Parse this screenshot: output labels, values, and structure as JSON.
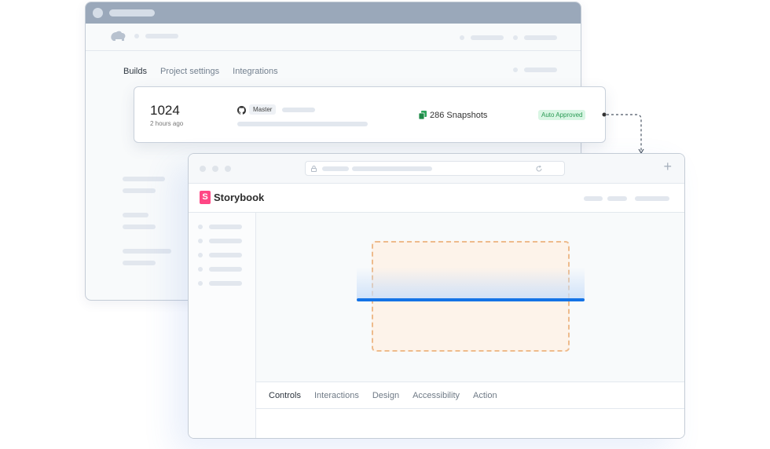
{
  "chromatic": {
    "tabs": [
      {
        "label": "Builds",
        "active": true
      },
      {
        "label": "Project settings",
        "active": false
      },
      {
        "label": "Integrations",
        "active": false
      }
    ]
  },
  "build_card": {
    "number": "1024",
    "time": "2 hours ago",
    "branch": "Master",
    "snapshots": "286 Snapshots",
    "status": "Auto Approved",
    "icons": [
      "github-icon",
      "snapshot-icon"
    ]
  },
  "storybook": {
    "title": "Storybook",
    "logo_letter": "S",
    "brand_color": "#ff4785",
    "addon_tabs": [
      {
        "label": "Controls",
        "active": true
      },
      {
        "label": "Interactions",
        "active": false
      },
      {
        "label": "Design",
        "active": false
      },
      {
        "label": "Accessibility",
        "active": false
      },
      {
        "label": "Action",
        "active": false
      }
    ]
  },
  "colors": {
    "scan_line": "#1473e6",
    "badge_bg": "#d9f6e4",
    "badge_text": "#2a9a54",
    "dashed_box": "#eebb8c"
  }
}
